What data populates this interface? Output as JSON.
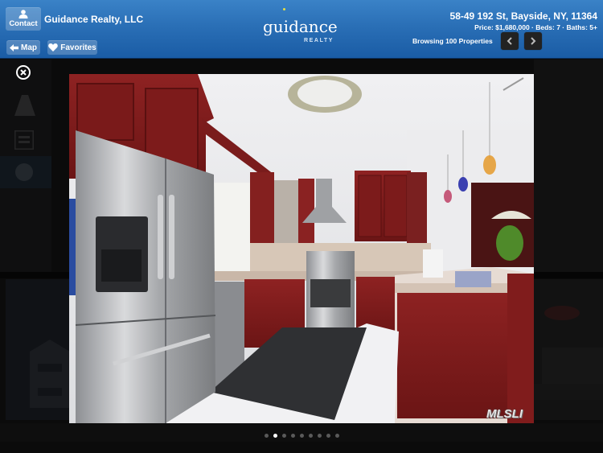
{
  "header": {
    "company_name": "Guidance Realty, LLC",
    "contact_label": "Contact",
    "map_label": "Map",
    "favorites_label": "Favorites",
    "logo": {
      "main": "guidance",
      "sub": "REALTY"
    },
    "address": "58-49 192 St, Bayside, NY, 11364",
    "specs": "Price: $1,680,000 · Beds: 7 · Baths: 5+",
    "browsing": "Browsing 100 Properties",
    "prev_icon": "chevron-left-icon",
    "next_icon": "chevron-right-icon"
  },
  "viewer": {
    "close_icon": "close-circle-icon",
    "photo_description": "Kitchen with cherry wood cabinets, stainless steel refrigerator, range and hood",
    "watermark": "MLSLI",
    "pager": {
      "total": 9,
      "current": 2
    }
  },
  "background": {
    "sidebar_icons": [
      "road-icon",
      "list-icon",
      "play-icon"
    ]
  },
  "colors": {
    "header_blue": "#2a6fb6",
    "cabinet_red": "#8a1f1f",
    "overlay": "#0b0b0b"
  }
}
